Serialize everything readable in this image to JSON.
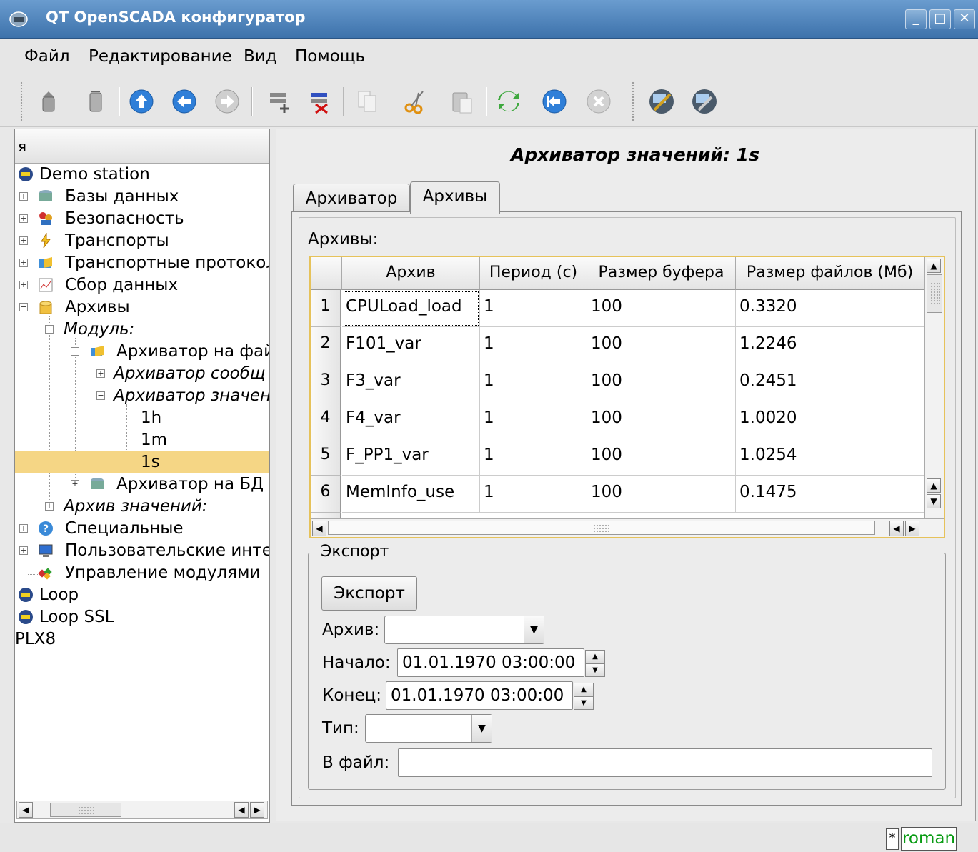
{
  "window": {
    "title": "QT OpenSCADA конфигуратор",
    "min": "_",
    "max": "□",
    "close": "✕"
  },
  "menu": [
    "Файл",
    "Редактирование",
    "Вид",
    "Помощь"
  ],
  "tree": {
    "header": "я",
    "items": [
      {
        "label": "Demo station"
      },
      {
        "label": "Базы данных"
      },
      {
        "label": "Безопасность"
      },
      {
        "label": "Транспорты"
      },
      {
        "label": "Транспортные протокол"
      },
      {
        "label": "Сбор данных"
      },
      {
        "label": "Архивы"
      },
      {
        "label": "Модуль:"
      },
      {
        "label": "Архиватор на фай"
      },
      {
        "label": "Архиватор сообщ"
      },
      {
        "label": "Архиватор значен"
      },
      {
        "label": "1h"
      },
      {
        "label": "1m"
      },
      {
        "label": "1s"
      },
      {
        "label": "Архиватор на БД"
      },
      {
        "label": "Архив значений:"
      },
      {
        "label": "Специальные"
      },
      {
        "label": "Пользовательские интер"
      },
      {
        "label": "Управление модулями"
      },
      {
        "label": "Loop"
      },
      {
        "label": "Loop SSL"
      },
      {
        "label": "PLX8"
      }
    ]
  },
  "page": {
    "title": "Архиватор значений: 1s",
    "tabs": [
      "Архиватор",
      "Архивы"
    ],
    "active_tab": "Архивы",
    "archives_label": "Архивы:",
    "table": {
      "columns": [
        "Архив",
        "Период (с)",
        "Размер буфера",
        "Размер файлов (Мб)"
      ],
      "rows": [
        {
          "n": "1",
          "archive": "CPULoad_load",
          "period": "1",
          "buffer": "100",
          "size": "0.3320"
        },
        {
          "n": "2",
          "archive": "F101_var",
          "period": "1",
          "buffer": "100",
          "size": "1.2246"
        },
        {
          "n": "3",
          "archive": "F3_var",
          "period": "1",
          "buffer": "100",
          "size": "0.2451"
        },
        {
          "n": "4",
          "archive": "F4_var",
          "period": "1",
          "buffer": "100",
          "size": "1.0020"
        },
        {
          "n": "5",
          "archive": "F_PP1_var",
          "period": "1",
          "buffer": "100",
          "size": "1.0254"
        },
        {
          "n": "6",
          "archive": "MemInfo_use",
          "period": "1",
          "buffer": "100",
          "size": "0.1475"
        }
      ]
    },
    "export": {
      "group_title": "Экспорт",
      "button": "Экспорт",
      "archive_label": "Архив:",
      "archive_value": "",
      "begin_label": "Начало:",
      "begin_value": "01.01.1970 03:00:00",
      "end_label": "Конец:",
      "end_value": "01.01.1970 03:00:00",
      "type_label": "Тип:",
      "type_value": "",
      "file_label": "В файл:",
      "file_value": ""
    }
  },
  "status": {
    "flag": "*",
    "user": "roman"
  },
  "colors": {
    "title_bar": "#3d72ab",
    "selection": "#f5d685",
    "table_border": "#e6c25a",
    "user_text": "#079b12"
  }
}
